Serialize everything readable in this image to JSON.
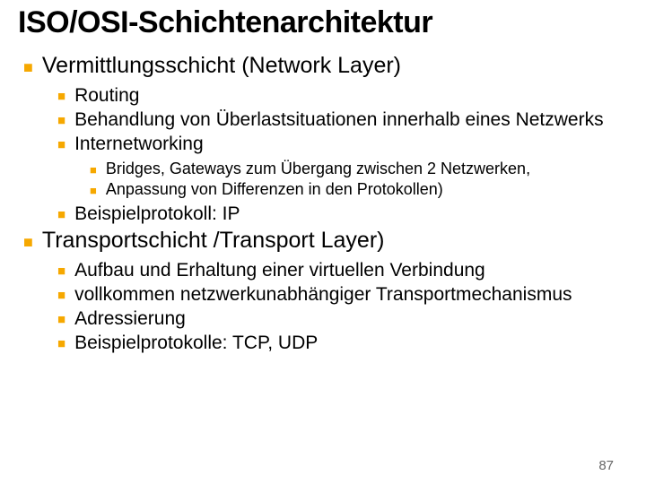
{
  "title": "ISO/OSI-Schichtenarchitektur",
  "page_number": "87",
  "sections": [
    {
      "heading": "Vermittlungsschicht (Network Layer)",
      "items": [
        {
          "text": "Routing"
        },
        {
          "text": "Behandlung von Überlastsituationen innerhalb eines Netzwerks"
        },
        {
          "text": "Internetworking",
          "subitems": [
            "Bridges, Gateways zum Übergang zwischen 2 Netzwerken,",
            "Anpassung von Differenzen in den Protokollen)"
          ]
        },
        {
          "text": "Beispielprotokoll: IP"
        }
      ]
    },
    {
      "heading": "Transportschicht /Transport Layer)",
      "items": [
        {
          "text": "Aufbau und Erhaltung einer virtuellen Verbindung"
        },
        {
          "text": "vollkommen netzwerkunabhängiger Transportmechanismus"
        },
        {
          "text": "Adressierung"
        },
        {
          "text": "Beispielprotokolle: TCP, UDP"
        }
      ]
    }
  ]
}
